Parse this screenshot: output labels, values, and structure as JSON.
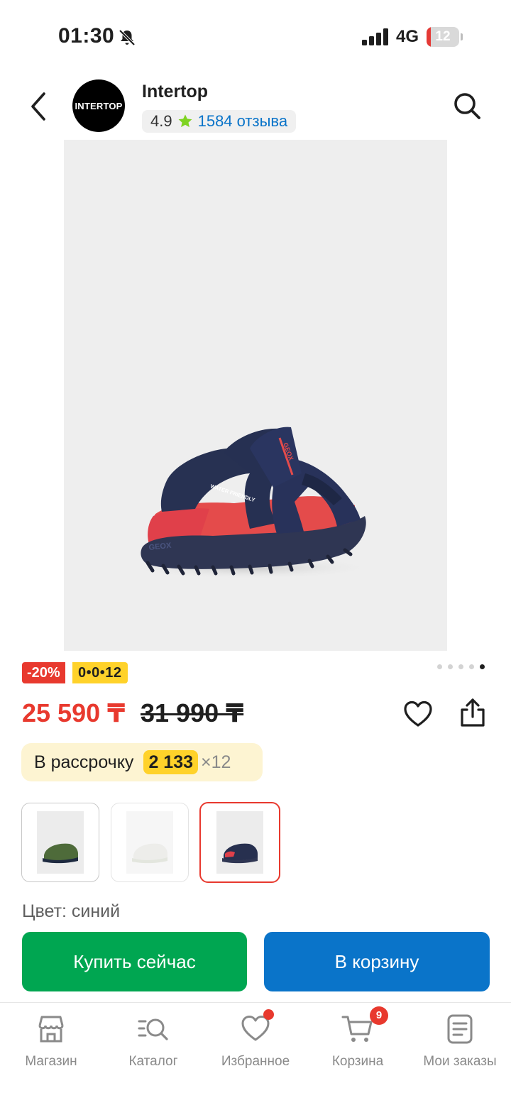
{
  "status_bar": {
    "time": "01:30",
    "network": "4G",
    "battery_level": "12",
    "battery_fraction": 0.12,
    "icons": [
      "bell-muted-icon",
      "signal-icon",
      "battery-icon"
    ]
  },
  "header": {
    "store_logo_text": "INTERTOP",
    "store_name": "Intertop",
    "rating": "4.9",
    "reviews": "1584 отзыва",
    "icons": [
      "back-icon",
      "star-icon",
      "search-icon"
    ],
    "star_color": "#7ed321"
  },
  "product": {
    "image_icon": "sandal-image",
    "image_texts": [
      "WATER FRIENDLY",
      "GEOX",
      "GEOX"
    ],
    "discount_badge": "-20%",
    "installment_badge": "0•0•12",
    "pager_total": 5,
    "pager_active": 5,
    "price": "25 590 ₸",
    "old_price": "31 990 ₸",
    "installment": {
      "label": "В рассрочку",
      "amount": "2 133",
      "times": "×12"
    },
    "swatches": [
      "green",
      "white",
      "navy"
    ],
    "selected_swatch": "navy",
    "color_label": "Цвет: синий"
  },
  "actions": {
    "buy_now": "Купить сейчас",
    "add_to_cart": "В корзину"
  },
  "bottom_nav": {
    "items": [
      {
        "label": "Магазин",
        "icon": "store-icon"
      },
      {
        "label": "Каталог",
        "icon": "catalog-search-icon"
      },
      {
        "label": "Избранное",
        "icon": "heart-icon"
      },
      {
        "label": "Корзина",
        "icon": "cart-icon"
      },
      {
        "label": "Мои заказы",
        "icon": "orders-icon"
      }
    ],
    "cart_count": "9"
  },
  "colors": {
    "accent_red": "#e8392e",
    "accent_yellow": "#ffd22a",
    "buy_green": "#00a651",
    "cart_blue": "#0a74c9"
  }
}
